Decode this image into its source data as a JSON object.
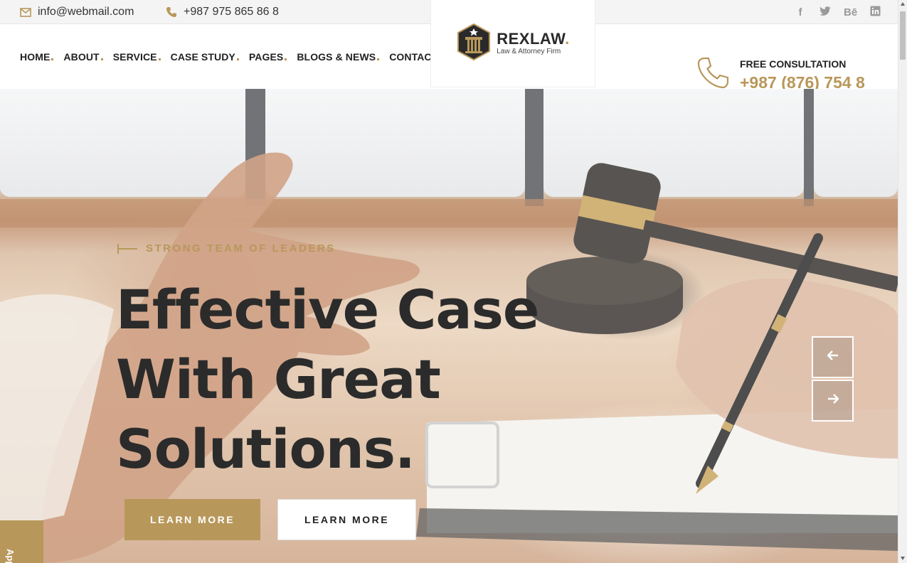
{
  "topbar": {
    "email": "info@webmail.com",
    "phone": "+987 975 865 86 8",
    "social": [
      "f",
      "t",
      "Bē",
      "in"
    ],
    "social_icons": [
      "facebook-icon",
      "twitter-icon",
      "behance-icon",
      "linkedin-icon"
    ]
  },
  "nav": {
    "items": [
      "HOME",
      "ABOUT",
      "SERVICE",
      "CASE STUDY",
      "PAGES",
      "BLOGS & NEWS",
      "CONTACT"
    ]
  },
  "logo": {
    "name": "REXLAW",
    "dot": ".",
    "tagline": "Law & Attorney Firm"
  },
  "consultation": {
    "label": "FREE CONSULTATION",
    "phone": "+987 (876) 754 8"
  },
  "hero": {
    "tagline": "STRONG TEAM OF LEADERS",
    "headline_lines": [
      "Effective Case",
      "With Great",
      "Solutions."
    ],
    "primary_button": "LEARN MORE",
    "secondary_button": "LEARN MORE"
  },
  "side_tab": {
    "label": "Apply"
  },
  "colors": {
    "accent": "#b8975a",
    "dark": "#2b2b2b"
  }
}
